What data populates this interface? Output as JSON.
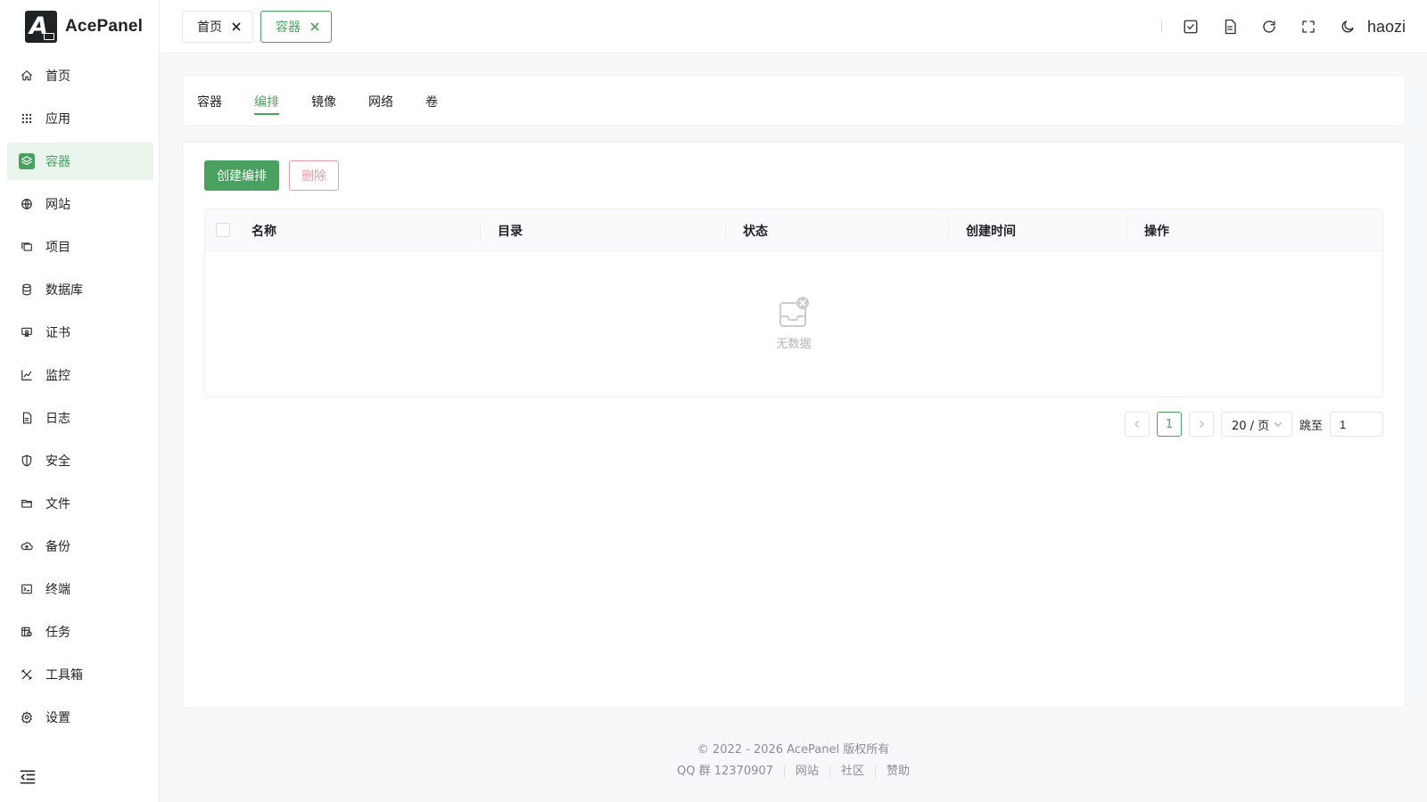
{
  "app": {
    "name": "AcePanel"
  },
  "sidebar": {
    "items": [
      {
        "label": "首页",
        "icon": "home-icon"
      },
      {
        "label": "应用",
        "icon": "apps-icon"
      },
      {
        "label": "容器",
        "icon": "container-icon",
        "active": true
      },
      {
        "label": "网站",
        "icon": "globe-icon"
      },
      {
        "label": "项目",
        "icon": "project-icon"
      },
      {
        "label": "数据库",
        "icon": "database-icon"
      },
      {
        "label": "证书",
        "icon": "certificate-icon"
      },
      {
        "label": "监控",
        "icon": "chart-icon"
      },
      {
        "label": "日志",
        "icon": "log-icon"
      },
      {
        "label": "安全",
        "icon": "shield-icon"
      },
      {
        "label": "文件",
        "icon": "folder-icon"
      },
      {
        "label": "备份",
        "icon": "cloud-backup-icon"
      },
      {
        "label": "终端",
        "icon": "terminal-icon"
      },
      {
        "label": "任务",
        "icon": "task-icon"
      },
      {
        "label": "工具箱",
        "icon": "tools-icon"
      },
      {
        "label": "设置",
        "icon": "gear-icon"
      }
    ]
  },
  "header": {
    "tabs": [
      {
        "label": "首页",
        "active": false
      },
      {
        "label": "容器",
        "active": true
      }
    ],
    "username": "haozi"
  },
  "subtabs": [
    "容器",
    "编排",
    "镜像",
    "网络",
    "卷"
  ],
  "toolbar": {
    "create_label": "创建编排",
    "delete_label": "删除"
  },
  "table": {
    "columns": [
      "名称",
      "目录",
      "状态",
      "创建时间",
      "操作"
    ],
    "rows": [],
    "empty_text": "无数据"
  },
  "pagination": {
    "current_page": "1",
    "page_size": "20 / 页",
    "jump_label": "跳至",
    "jump_value": "1"
  },
  "footer": {
    "copyright": "© 2022 - 2026 AcePanel 版权所有",
    "qq": "QQ 群 12370907",
    "links": [
      "网站",
      "社区",
      "赞助"
    ]
  },
  "colors": {
    "accent": "#4aa05f",
    "danger": "#e69ca4",
    "active_bg": "#e8f4ec"
  }
}
